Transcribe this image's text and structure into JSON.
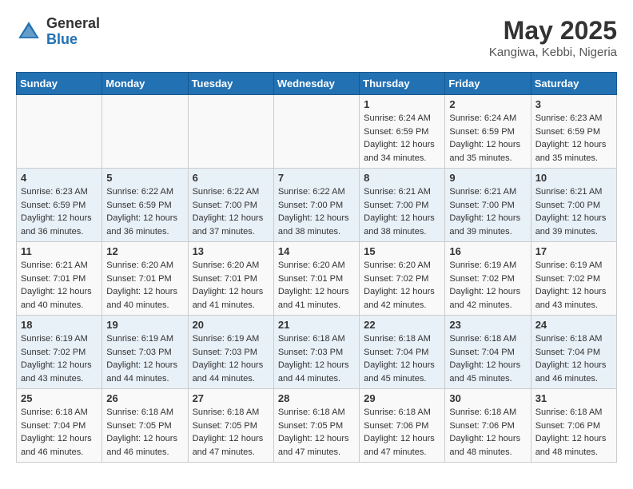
{
  "header": {
    "logo": {
      "general": "General",
      "blue": "Blue"
    },
    "title": "May 2025",
    "location": "Kangiwa, Kebbi, Nigeria"
  },
  "weekdays": [
    "Sunday",
    "Monday",
    "Tuesday",
    "Wednesday",
    "Thursday",
    "Friday",
    "Saturday"
  ],
  "weeks": [
    [
      {
        "day": "",
        "info": ""
      },
      {
        "day": "",
        "info": ""
      },
      {
        "day": "",
        "info": ""
      },
      {
        "day": "",
        "info": ""
      },
      {
        "day": "1",
        "info": "Sunrise: 6:24 AM\nSunset: 6:59 PM\nDaylight: 12 hours\nand 34 minutes."
      },
      {
        "day": "2",
        "info": "Sunrise: 6:24 AM\nSunset: 6:59 PM\nDaylight: 12 hours\nand 35 minutes."
      },
      {
        "day": "3",
        "info": "Sunrise: 6:23 AM\nSunset: 6:59 PM\nDaylight: 12 hours\nand 35 minutes."
      }
    ],
    [
      {
        "day": "4",
        "info": "Sunrise: 6:23 AM\nSunset: 6:59 PM\nDaylight: 12 hours\nand 36 minutes."
      },
      {
        "day": "5",
        "info": "Sunrise: 6:22 AM\nSunset: 6:59 PM\nDaylight: 12 hours\nand 36 minutes."
      },
      {
        "day": "6",
        "info": "Sunrise: 6:22 AM\nSunset: 7:00 PM\nDaylight: 12 hours\nand 37 minutes."
      },
      {
        "day": "7",
        "info": "Sunrise: 6:22 AM\nSunset: 7:00 PM\nDaylight: 12 hours\nand 38 minutes."
      },
      {
        "day": "8",
        "info": "Sunrise: 6:21 AM\nSunset: 7:00 PM\nDaylight: 12 hours\nand 38 minutes."
      },
      {
        "day": "9",
        "info": "Sunrise: 6:21 AM\nSunset: 7:00 PM\nDaylight: 12 hours\nand 39 minutes."
      },
      {
        "day": "10",
        "info": "Sunrise: 6:21 AM\nSunset: 7:00 PM\nDaylight: 12 hours\nand 39 minutes."
      }
    ],
    [
      {
        "day": "11",
        "info": "Sunrise: 6:21 AM\nSunset: 7:01 PM\nDaylight: 12 hours\nand 40 minutes."
      },
      {
        "day": "12",
        "info": "Sunrise: 6:20 AM\nSunset: 7:01 PM\nDaylight: 12 hours\nand 40 minutes."
      },
      {
        "day": "13",
        "info": "Sunrise: 6:20 AM\nSunset: 7:01 PM\nDaylight: 12 hours\nand 41 minutes."
      },
      {
        "day": "14",
        "info": "Sunrise: 6:20 AM\nSunset: 7:01 PM\nDaylight: 12 hours\nand 41 minutes."
      },
      {
        "day": "15",
        "info": "Sunrise: 6:20 AM\nSunset: 7:02 PM\nDaylight: 12 hours\nand 42 minutes."
      },
      {
        "day": "16",
        "info": "Sunrise: 6:19 AM\nSunset: 7:02 PM\nDaylight: 12 hours\nand 42 minutes."
      },
      {
        "day": "17",
        "info": "Sunrise: 6:19 AM\nSunset: 7:02 PM\nDaylight: 12 hours\nand 43 minutes."
      }
    ],
    [
      {
        "day": "18",
        "info": "Sunrise: 6:19 AM\nSunset: 7:02 PM\nDaylight: 12 hours\nand 43 minutes."
      },
      {
        "day": "19",
        "info": "Sunrise: 6:19 AM\nSunset: 7:03 PM\nDaylight: 12 hours\nand 44 minutes."
      },
      {
        "day": "20",
        "info": "Sunrise: 6:19 AM\nSunset: 7:03 PM\nDaylight: 12 hours\nand 44 minutes."
      },
      {
        "day": "21",
        "info": "Sunrise: 6:18 AM\nSunset: 7:03 PM\nDaylight: 12 hours\nand 44 minutes."
      },
      {
        "day": "22",
        "info": "Sunrise: 6:18 AM\nSunset: 7:04 PM\nDaylight: 12 hours\nand 45 minutes."
      },
      {
        "day": "23",
        "info": "Sunrise: 6:18 AM\nSunset: 7:04 PM\nDaylight: 12 hours\nand 45 minutes."
      },
      {
        "day": "24",
        "info": "Sunrise: 6:18 AM\nSunset: 7:04 PM\nDaylight: 12 hours\nand 46 minutes."
      }
    ],
    [
      {
        "day": "25",
        "info": "Sunrise: 6:18 AM\nSunset: 7:04 PM\nDaylight: 12 hours\nand 46 minutes."
      },
      {
        "day": "26",
        "info": "Sunrise: 6:18 AM\nSunset: 7:05 PM\nDaylight: 12 hours\nand 46 minutes."
      },
      {
        "day": "27",
        "info": "Sunrise: 6:18 AM\nSunset: 7:05 PM\nDaylight: 12 hours\nand 47 minutes."
      },
      {
        "day": "28",
        "info": "Sunrise: 6:18 AM\nSunset: 7:05 PM\nDaylight: 12 hours\nand 47 minutes."
      },
      {
        "day": "29",
        "info": "Sunrise: 6:18 AM\nSunset: 7:06 PM\nDaylight: 12 hours\nand 47 minutes."
      },
      {
        "day": "30",
        "info": "Sunrise: 6:18 AM\nSunset: 7:06 PM\nDaylight: 12 hours\nand 48 minutes."
      },
      {
        "day": "31",
        "info": "Sunrise: 6:18 AM\nSunset: 7:06 PM\nDaylight: 12 hours\nand 48 minutes."
      }
    ]
  ]
}
